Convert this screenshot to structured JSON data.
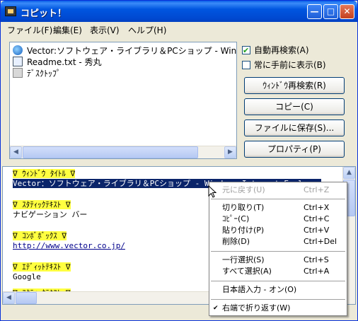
{
  "window": {
    "title": "コピット！",
    "controls": {
      "minimize": "—",
      "maximize": "□",
      "close": "✕"
    }
  },
  "menu": [
    "ファイル(F)",
    "編集(E)",
    "表示(V)",
    "ヘルプ(H)"
  ],
  "window_list": [
    {
      "label": "Vector:ソフトウェア・ライブラリ＆PCショップ - Windows Ir",
      "icon": "ie-icon"
    },
    {
      "label": "Readme.txt - 秀丸",
      "icon": "notepad-icon"
    },
    {
      "label": "ﾃﾞｽｸﾄｯﾌﾟ",
      "icon": "desktop-icon"
    }
  ],
  "options": {
    "auto_research": {
      "label": "自動再検索(A)",
      "checked": true
    },
    "always_on_top": {
      "label": "常に手前に表示(B)",
      "checked": false
    }
  },
  "buttons": {
    "research": "ｳｨﾝﾄﾞｳ再検索(R)",
    "copy": "コピー(C)",
    "save": "ファイルに保存(S)...",
    "properties": "プロパティ(P)"
  },
  "editor": {
    "lines": [
      {
        "text": "∇ ｳｨﾝﾄﾞｳ ﾀｲﾄﾙ ∇",
        "style": "heading"
      },
      {
        "text": "Vector：ソフトウェア・ライブラリ＆PCショップ - Windows Internet Explorer",
        "style": "selected"
      },
      {
        "text": "∇ ｽﾀﾃｨｯｸﾃｷｽﾄ ∇",
        "style": "heading"
      },
      {
        "text": "ナビゲーション バー",
        "style": "plain"
      },
      {
        "text": "∇ ｺﾝﾎﾞﾎﾞｯｸｽ ∇",
        "style": "heading"
      },
      {
        "text": "http://www.vector.co.jp/",
        "style": "link"
      },
      {
        "text": "∇ ｴﾃﾞｨｯﾄﾃｷｽﾄ ∇",
        "style": "heading"
      },
      {
        "text": "Google",
        "style": "plain"
      },
      {
        "text": "∇ ｽﾀﾃｨｯｸﾃｷｽﾄ ∇",
        "style": "heading"
      }
    ]
  },
  "context_menu": [
    {
      "label": "元に戻す(U)",
      "key": "Ctrl+Z",
      "disabled": true
    },
    {
      "sep": true
    },
    {
      "label": "切り取り(T)",
      "key": "Ctrl+X"
    },
    {
      "label": "ｺﾋﾟｰ(C)",
      "key": "Ctrl+C"
    },
    {
      "label": "貼り付け(P)",
      "key": "Ctrl+V"
    },
    {
      "label": "削除(D)",
      "key": "Ctrl+Del"
    },
    {
      "sep": true
    },
    {
      "label": "一行選択(S)",
      "key": "Ctrl+S"
    },
    {
      "label": "すべて選択(A)",
      "key": "Ctrl+A"
    },
    {
      "sep": true
    },
    {
      "label": "日本語入力 - オン(O)",
      "key": ""
    },
    {
      "sep": true
    },
    {
      "label": "右端で折り返す(W)",
      "key": "",
      "checked": true
    }
  ]
}
